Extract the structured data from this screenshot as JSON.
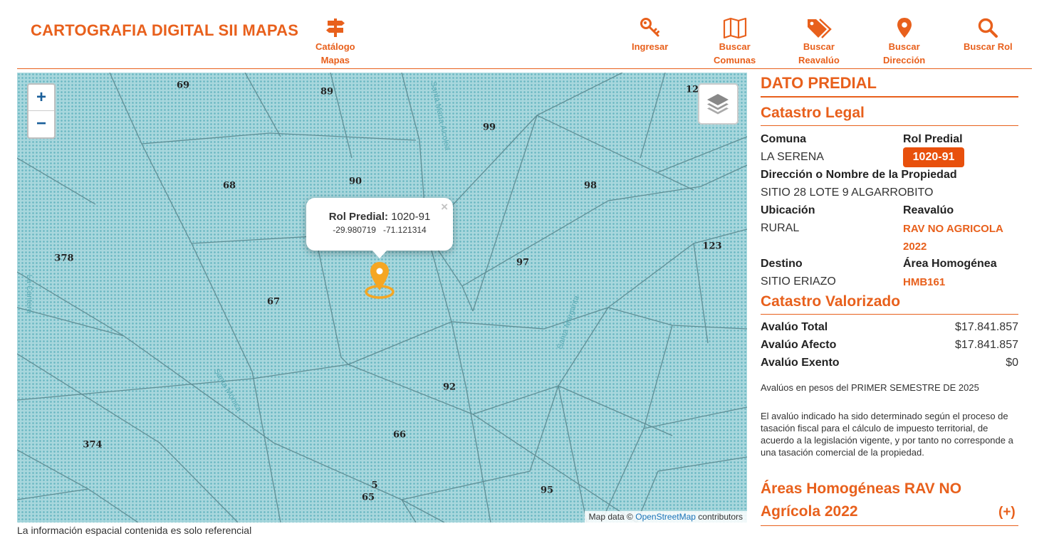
{
  "header": {
    "title": "CARTOGRAFIA DIGITAL SII MAPAS",
    "nav": [
      {
        "id": "catalogo",
        "label1": "Catálogo",
        "label2": "Mapas",
        "icon": "signpost-icon"
      },
      {
        "id": "ingresar",
        "label1": "Ingresar",
        "label2": "",
        "icon": "key-icon"
      },
      {
        "id": "comunas",
        "label1": "Buscar",
        "label2": "Comunas",
        "icon": "map-icon"
      },
      {
        "id": "reavaluo",
        "label1": "Buscar",
        "label2": "Reavalúo",
        "icon": "tags-icon"
      },
      {
        "id": "direccion",
        "label1": "Buscar",
        "label2": "Dirección",
        "icon": "location-pin-icon"
      },
      {
        "id": "rol",
        "label1": "Buscar Rol",
        "label2": "",
        "icon": "search-icon"
      }
    ]
  },
  "map": {
    "zoom_in": "+",
    "zoom_out": "−",
    "parcels": [
      "69",
      "89",
      "99",
      "12",
      "68",
      "90",
      "98",
      "378",
      "97",
      "123",
      "67",
      "92",
      "66",
      "374",
      "5",
      "65",
      "95"
    ],
    "streets": [
      "Santa María Alcolea",
      "La Cantera",
      "Santa Margarita",
      "Santa Mónica"
    ],
    "popup": {
      "rol_label": "Rol Predial:",
      "rol_value": "1020-91",
      "lat": "-29.980719",
      "lon": "-71.121314",
      "close": "×"
    },
    "attribution": {
      "prefix": "Map data ©",
      "link": "OpenStreetMap",
      "suffix": "contributors"
    }
  },
  "footer_text": "La información espacial contenida es solo referencial",
  "panel": {
    "title": "DATO PREDIAL",
    "legal": {
      "heading": "Catastro Legal",
      "comuna_label": "Comuna",
      "comuna_value": "LA SERENA",
      "rol_label": "Rol Predial",
      "rol_value": "1020-91",
      "direccion_label": "Dirección o Nombre de la Propiedad",
      "direccion_value": "SITIO 28 LOTE 9 ALGARROBITO",
      "ubicacion_label": "Ubicación",
      "ubicacion_value": "RURAL",
      "reavaluo_label": "Reavalúo",
      "reavaluo_value_1": "RAV NO AGRICOLA",
      "reavaluo_value_2": "2022",
      "destino_label": "Destino",
      "destino_value": "SITIO ERIAZO",
      "area_label": "Área Homogénea",
      "area_value": "HMB161"
    },
    "valorizado": {
      "heading": "Catastro Valorizado",
      "total_label": "Avalúo Total",
      "total_value": "$17.841.857",
      "afecto_label": "Avalúo Afecto",
      "afecto_value": "$17.841.857",
      "exento_label": "Avalúo Exento",
      "exento_value": "$0",
      "note1": "Avalúos en pesos del PRIMER SEMESTRE DE 2025",
      "note2": "El avalúo indicado ha sido determinado según el proceso de tasación fiscal para el cálculo de impuesto territorial, de acuerdo a la legislación vigente, y por tanto no corresponde a una tasación comercial de la propiedad."
    },
    "areas": {
      "heading_1": "Áreas Homogéneas RAV NO",
      "heading_2": "Agrícola 2022",
      "expand": "(+)"
    }
  },
  "colors": {
    "accent": "#e8601c",
    "badge": "#e8500c",
    "map_bg": "#a8d7dd",
    "pin": "#f5a623"
  }
}
